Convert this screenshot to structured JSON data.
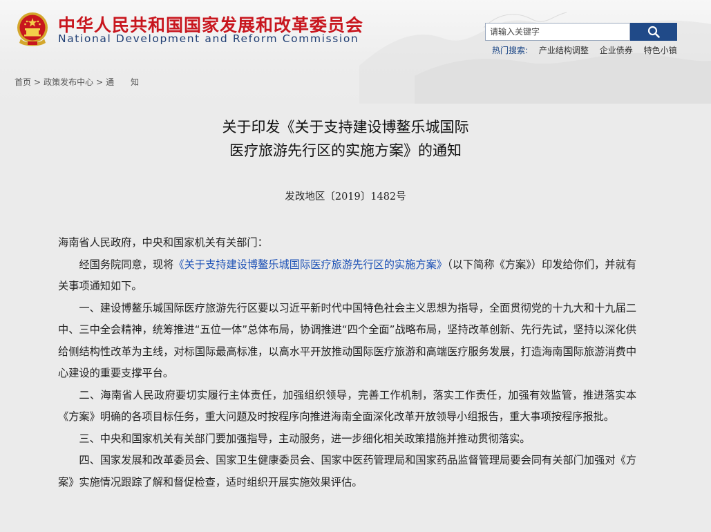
{
  "header": {
    "title_cn": "中华人民共和国国家发展和改革委员会",
    "title_en": "National Development and Reform Commission",
    "emblem_icon": "national-emblem-icon"
  },
  "search": {
    "placeholder": "请输入关键字",
    "button_icon": "search-icon"
  },
  "hot_search": {
    "label": "热门搜索:",
    "items": [
      "产业结构调整",
      "企业债券",
      "特色小镇"
    ]
  },
  "breadcrumb": {
    "items": [
      "首页",
      "政策发布中心",
      "通　　知"
    ],
    "separator": ">"
  },
  "article": {
    "title_line1": "关于印发《关于支持建设博鳌乐城国际",
    "title_line2": "医疗旅游先行区的实施方案》的通知",
    "doc_number": "发改地区〔2019〕1482号",
    "salutation": "海南省人民政府，中央和国家机关有关部门：",
    "para1_prefix": "经国务院同意，现将",
    "para1_link": "《关于支持建设博鳌乐城国际医疗旅游先行区的实施方案》",
    "para1_suffix": "（以下简称《方案》）印发给你们，并就有关事项通知如下。",
    "para2": "一、建设博鳌乐城国际医疗旅游先行区要以习近平新时代中国特色社会主义思想为指导，全面贯彻党的十九大和十九届二中、三中全会精神，统筹推进“五位一体”总体布局，协调推进“四个全面”战略布局，坚持改革创新、先行先试，坚持以深化供给侧结构性改革为主线，对标国际最高标准，以高水平开放推动国际医疗旅游和高端医疗服务发展，打造海南国际旅游消费中心建设的重要支撑平台。",
    "para3": "二、海南省人民政府要切实履行主体责任，加强组织领导，完善工作机制，落实工作责任，加强有效监管，推进落实本《方案》明确的各项目标任务，重大问题及时按程序向推进海南全面深化改革开放领导小组报告，重大事项按程序报批。",
    "para4": "三、中央和国家机关有关部门要加强指导，主动服务，进一步细化相关政策措施并推动贯彻落实。",
    "para5": "四、国家发展和改革委员会、国家卫生健康委员会、国家中医药管理局和国家药品监督管理局要会同有关部门加强对《方案》实施情况跟踪了解和督促检查，适时组织开展实施效果评估。"
  },
  "colors": {
    "title_red": "#c8161e",
    "title_blue": "#1f3e73",
    "search_button": "#204a88",
    "link_blue": "#1a4fb5"
  }
}
